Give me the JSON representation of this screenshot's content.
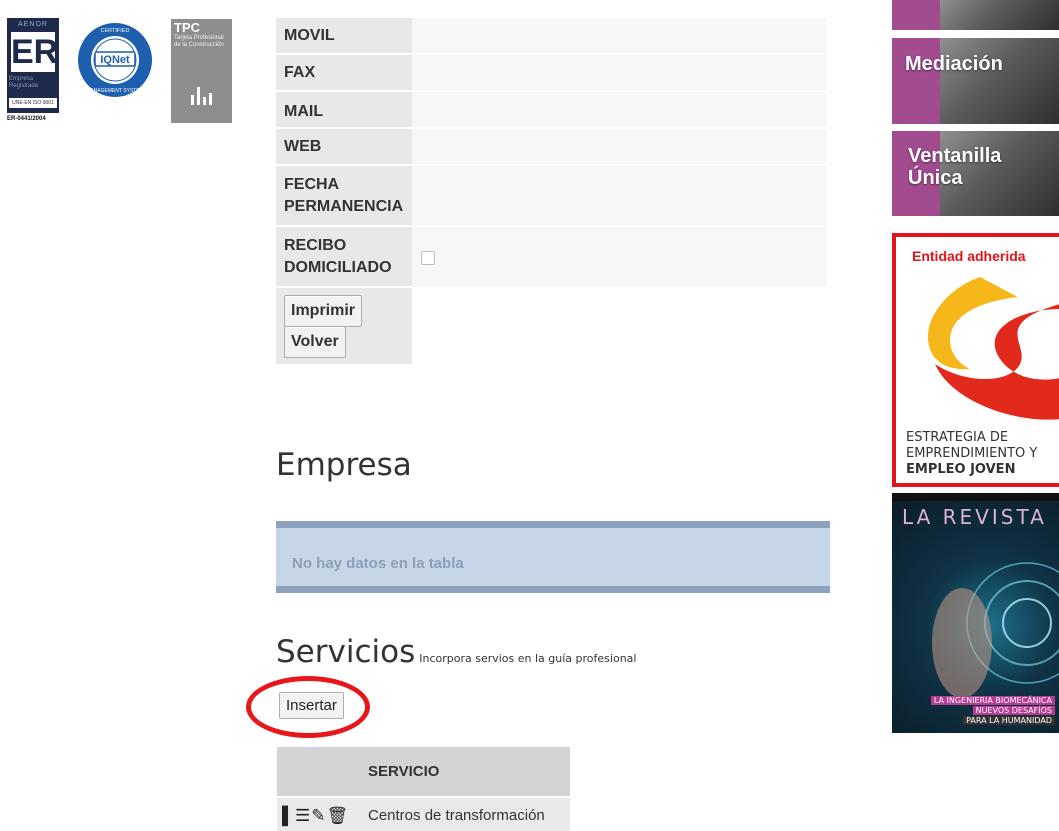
{
  "logos": {
    "aenor": {
      "top": "AENOR",
      "mark": "ER",
      "sub": "Empresa Registrada",
      "standard": "UNE-EN ISO 9001",
      "code": "ER-0441/2004"
    },
    "iqnet": {
      "ring": "CERTIFIED · MANAGEMENT SYSTEM",
      "name": "IQNet"
    },
    "tpc": {
      "title": "TPC",
      "sub": "Tarjeta Profesional de la Construcción"
    }
  },
  "contact_table": {
    "rows": [
      {
        "label": "MOVIL",
        "value": ""
      },
      {
        "label": "FAX",
        "value": ""
      },
      {
        "label": "MAIL",
        "value": ""
      },
      {
        "label": "WEB",
        "value": ""
      },
      {
        "label": "FECHA PERMANENCIA",
        "value": ""
      },
      {
        "label": "RECIBO DOMICILIADO",
        "value": "",
        "checked": false
      }
    ],
    "print_label": "Imprimir",
    "back_label": "Volver"
  },
  "empresa": {
    "heading": "Empresa",
    "empty_message": "No hay datos en la tabla"
  },
  "servicios": {
    "heading": "Servicios",
    "subtitle": "Incorpora servios en la guía profesional",
    "insert_label": "Insertar",
    "column_header": "SERVICIO",
    "rows": [
      {
        "name": "Centros de transformación"
      }
    ]
  },
  "sidebar": {
    "mediacion": "Mediación",
    "ventanilla_1": "Ventanilla",
    "ventanilla_2": "Única",
    "adherida_title": "Entidad adherida",
    "estrategia_1": "ESTRATEGIA DE",
    "estrategia_2": "EMPRENDIMIENTO Y",
    "estrategia_3": "EMPLEO JOVEN",
    "revista_title": "LA REVISTA",
    "revista_cap_1": "LA INGENIERIA BIOMECÁNICA",
    "revista_cap_2": "NUEVOS DESAFÍOS",
    "revista_cap_3": "PARA LA HUMANIDAD"
  },
  "colors": {
    "accent_purple": "#a24b8f",
    "alert_red": "#e6161a",
    "table_empty_bg": "#c6d6e8"
  }
}
